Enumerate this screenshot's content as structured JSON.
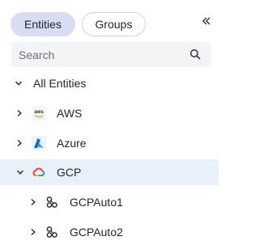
{
  "tabs": [
    {
      "label": "Entities",
      "active": true
    },
    {
      "label": "Groups",
      "active": false
    }
  ],
  "collapse_icon": "double-chevron-left-icon",
  "search": {
    "placeholder": "Search",
    "value": ""
  },
  "tree": {
    "root": {
      "label": "All Entities",
      "expanded": true
    },
    "providers": [
      {
        "label": "AWS",
        "icon": "aws-logo-icon",
        "expanded": false
      },
      {
        "label": "Azure",
        "icon": "azure-logo-icon",
        "expanded": false
      },
      {
        "label": "GCP",
        "icon": "gcp-logo-icon",
        "expanded": true,
        "selected": true
      }
    ],
    "gcp_children": [
      {
        "label": "GCPAuto1",
        "icon": "group-nodes-icon"
      },
      {
        "label": "GCPAuto2",
        "icon": "group-nodes-icon"
      }
    ]
  },
  "colors": {
    "active_tab_bg": "#d9dcf3",
    "selected_row_bg": "#e8f1fa",
    "azure_blue": "#0a6fd3",
    "aws_orange": "#ff9900"
  }
}
